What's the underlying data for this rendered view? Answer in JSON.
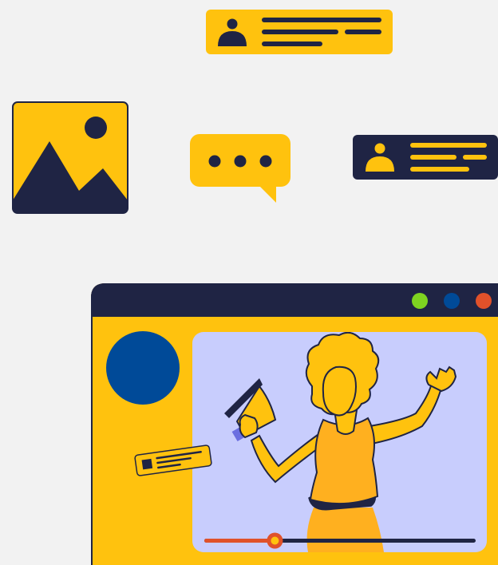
{
  "colors": {
    "background": "#f2f2f2",
    "yellow": "#ffc20e",
    "navy": "#1f2444",
    "blue": "#004a98",
    "lavender": "#c8cdfd",
    "orange_accent": "#e0512a",
    "green_dot": "#7ed321",
    "red_dot": "#e0512a",
    "figure_orange": "#ffb01f"
  },
  "icons": {
    "profile_card_top": "user-profile-card-icon",
    "image_placeholder": "image-landscape-icon",
    "chat_bubble": "chat-bubble-icon",
    "profile_card_right": "user-profile-card-icon",
    "megaphone": "megaphone-icon"
  },
  "player": {
    "progress": 0.26,
    "window_controls": [
      "green",
      "blue",
      "red"
    ]
  }
}
